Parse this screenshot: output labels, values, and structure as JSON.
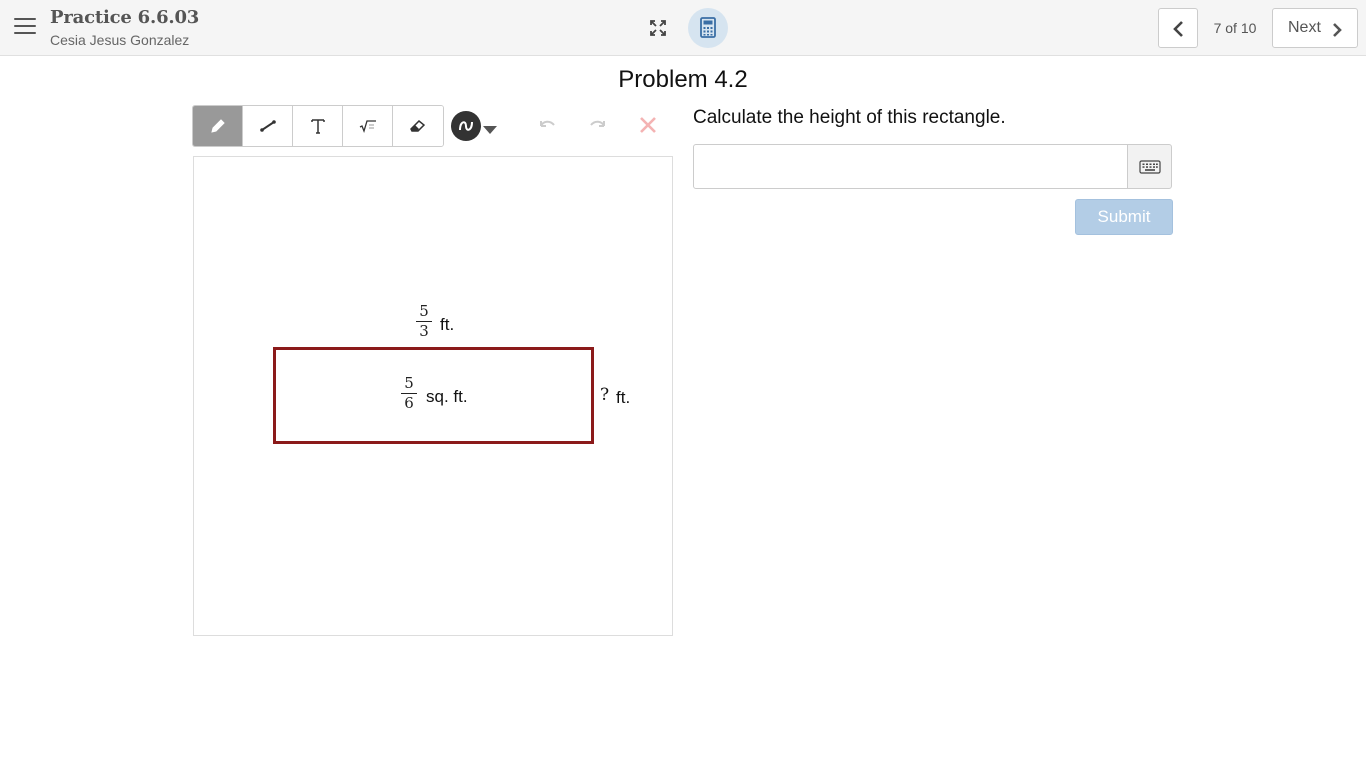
{
  "header": {
    "title": "Practice 6.6.03",
    "student": "Cesia Jesus Gonzalez",
    "page_count": "7 of 10",
    "next_label": "Next"
  },
  "problem": {
    "title": "Problem 4.2",
    "question": "Calculate the height of this rectangle.",
    "answer_value": "",
    "submit_label": "Submit"
  },
  "figure": {
    "width_num": "5",
    "width_den": "3",
    "width_unit": "ft.",
    "area_num": "5",
    "area_den": "6",
    "area_unit": "sq. ft.",
    "height_mark": "?",
    "height_unit": "ft."
  },
  "toolbar": {
    "tools": [
      "pencil",
      "line",
      "text",
      "math",
      "eraser"
    ],
    "active_tool": "pencil",
    "selected_color": "#333333"
  },
  "colors": {
    "rectangle_border": "#8b1a1a",
    "submit_disabled": "#b3cde6",
    "calculator_bg": "#d6e4f0"
  }
}
